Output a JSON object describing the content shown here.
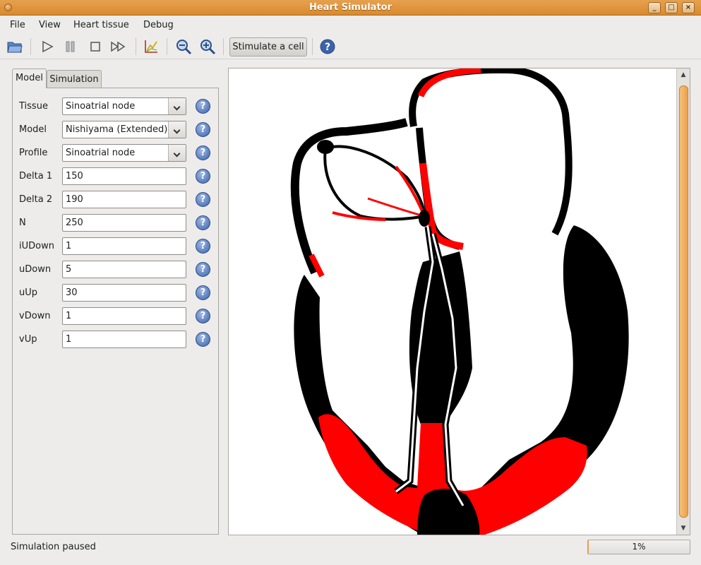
{
  "window": {
    "title": "Heart Simulator"
  },
  "menu": [
    {
      "label": "File"
    },
    {
      "label": "View"
    },
    {
      "label": "Heart tissue"
    },
    {
      "label": "Debug"
    }
  ],
  "toolbar": {
    "icons": [
      "open-folder-icon",
      "play-icon",
      "pause-icon",
      "stop-icon",
      "fast-forward-icon",
      "graph-icon",
      "zoom-out-icon",
      "zoom-in-icon",
      "help-icon"
    ],
    "stimulate_label": "Stimulate a cell"
  },
  "tabs": [
    {
      "label": "Model",
      "active": true
    },
    {
      "label": "Simulation",
      "active": false
    }
  ],
  "form": {
    "tissue": {
      "label": "Tissue",
      "value": "Sinoatrial node"
    },
    "model": {
      "label": "Model",
      "value": "Nishiyama (Extended)"
    },
    "profile": {
      "label": "Profile",
      "value": "Sinoatrial node"
    },
    "fields": [
      {
        "label": "Delta 1",
        "value": "150"
      },
      {
        "label": "Delta 2",
        "value": "190"
      },
      {
        "label": "N",
        "value": "250"
      },
      {
        "label": "iUDown",
        "value": "1"
      },
      {
        "label": "uDown",
        "value": "5"
      },
      {
        "label": "uUp",
        "value": "30"
      },
      {
        "label": "vDown",
        "value": "1"
      },
      {
        "label": "vUp",
        "value": "1"
      }
    ]
  },
  "colors": {
    "active_tissue": "#ff0000",
    "resting_tissue": "#000000",
    "accent": "#eca04a"
  },
  "status": {
    "text": "Simulation paused",
    "progress_label": "1%",
    "progress_fraction": 0.01
  }
}
